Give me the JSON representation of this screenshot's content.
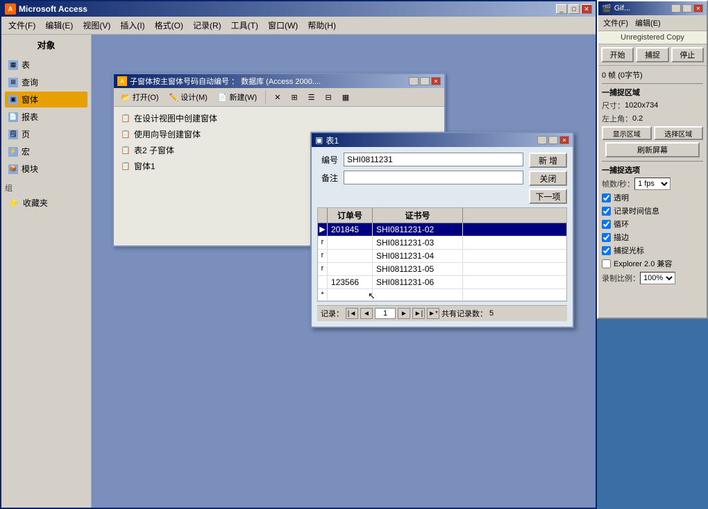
{
  "app": {
    "title": "Microsoft Access",
    "title_icon": "A"
  },
  "menu": {
    "items": [
      "文件(F)",
      "编辑(E)",
      "视图(V)",
      "插入(I)",
      "格式(O)",
      "记录(R)",
      "工具(T)",
      "窗口(W)",
      "帮助(H)"
    ]
  },
  "db_window": {
    "title": "子窗体按主窗体号码自动编号 ： 数据库 (Access 2000....",
    "toolbar": {
      "open": "打开(O)",
      "design": "设计(M)",
      "new": "新建(W)"
    },
    "nav_items": [
      {
        "label": "表",
        "group": false
      },
      {
        "label": "查询",
        "group": false
      },
      {
        "label": "窗体",
        "group": false,
        "active": true
      },
      {
        "label": "报表",
        "group": false
      },
      {
        "label": "页",
        "group": false
      },
      {
        "label": "宏",
        "group": false
      },
      {
        "label": "模块",
        "group": false
      }
    ],
    "nav_group": "组",
    "nav_group_item": "收藏夹",
    "list_items": [
      "在设计视图中创建窗体",
      "使用向导创建窗体",
      "表2 子窗体",
      "窗体1"
    ]
  },
  "form_window": {
    "title": "表1",
    "field_bianhao_label": "编号",
    "field_bianhao_value": "SHI0811231",
    "field_beizhu_label": "备注",
    "field_beizhu_value": "",
    "btn_new": "新 增",
    "btn_close": "关闭",
    "btn_next": "下一项",
    "grid": {
      "headers": [
        "订单号",
        "证书号"
      ],
      "rows": [
        {
          "marker": "▶",
          "col1": "201845",
          "col2": "SHI0811231-02",
          "selected": true
        },
        {
          "marker": "r",
          "col1": "",
          "col2": "SHI0811231-03"
        },
        {
          "marker": "r",
          "col1": "",
          "col2": "SHI0811231-04"
        },
        {
          "marker": "r",
          "col1": "",
          "col2": "SHI0811231-05"
        },
        {
          "marker": "",
          "col1": "123566",
          "col2": "SHI0811231-06"
        },
        {
          "marker": "*",
          "col1": "",
          "col2": ""
        }
      ]
    },
    "nav": {
      "record_label": "记录：",
      "current": "1",
      "total_label": "共有记录数：",
      "total": "5"
    }
  },
  "gif_panel": {
    "title": "Gif...",
    "menu_file": "文件(F)",
    "menu_edit": "编辑(E)",
    "unregistered": "Unregistered Copy",
    "btn_start": "开始",
    "btn_capture": "捕捉",
    "btn_stop": "停止",
    "frame_info": "0 帧 (0字节)",
    "capture_area_title": "一捕捉区域",
    "size_label": "尺寸：",
    "size_value": "1020x734",
    "topleft_label": "左上角：",
    "topleft_value": "0.2",
    "btn_show_area": "显示区域",
    "btn_select_area": "选择区域",
    "btn_refresh": "刷新屏幕",
    "options_title": "一捕捉选项",
    "fps_label": "帧数/秒：",
    "fps_value": "1 fps",
    "cb_transparent": "透明",
    "cb_record_time": "记录时间信息",
    "cb_loop": "循环",
    "cb_border": "描边",
    "cb_capture_cursor": "捕捉光标",
    "cb_explorer": "Explorer 2.0 兼容",
    "scale_label": "录制比例：",
    "scale_value": "100%"
  }
}
